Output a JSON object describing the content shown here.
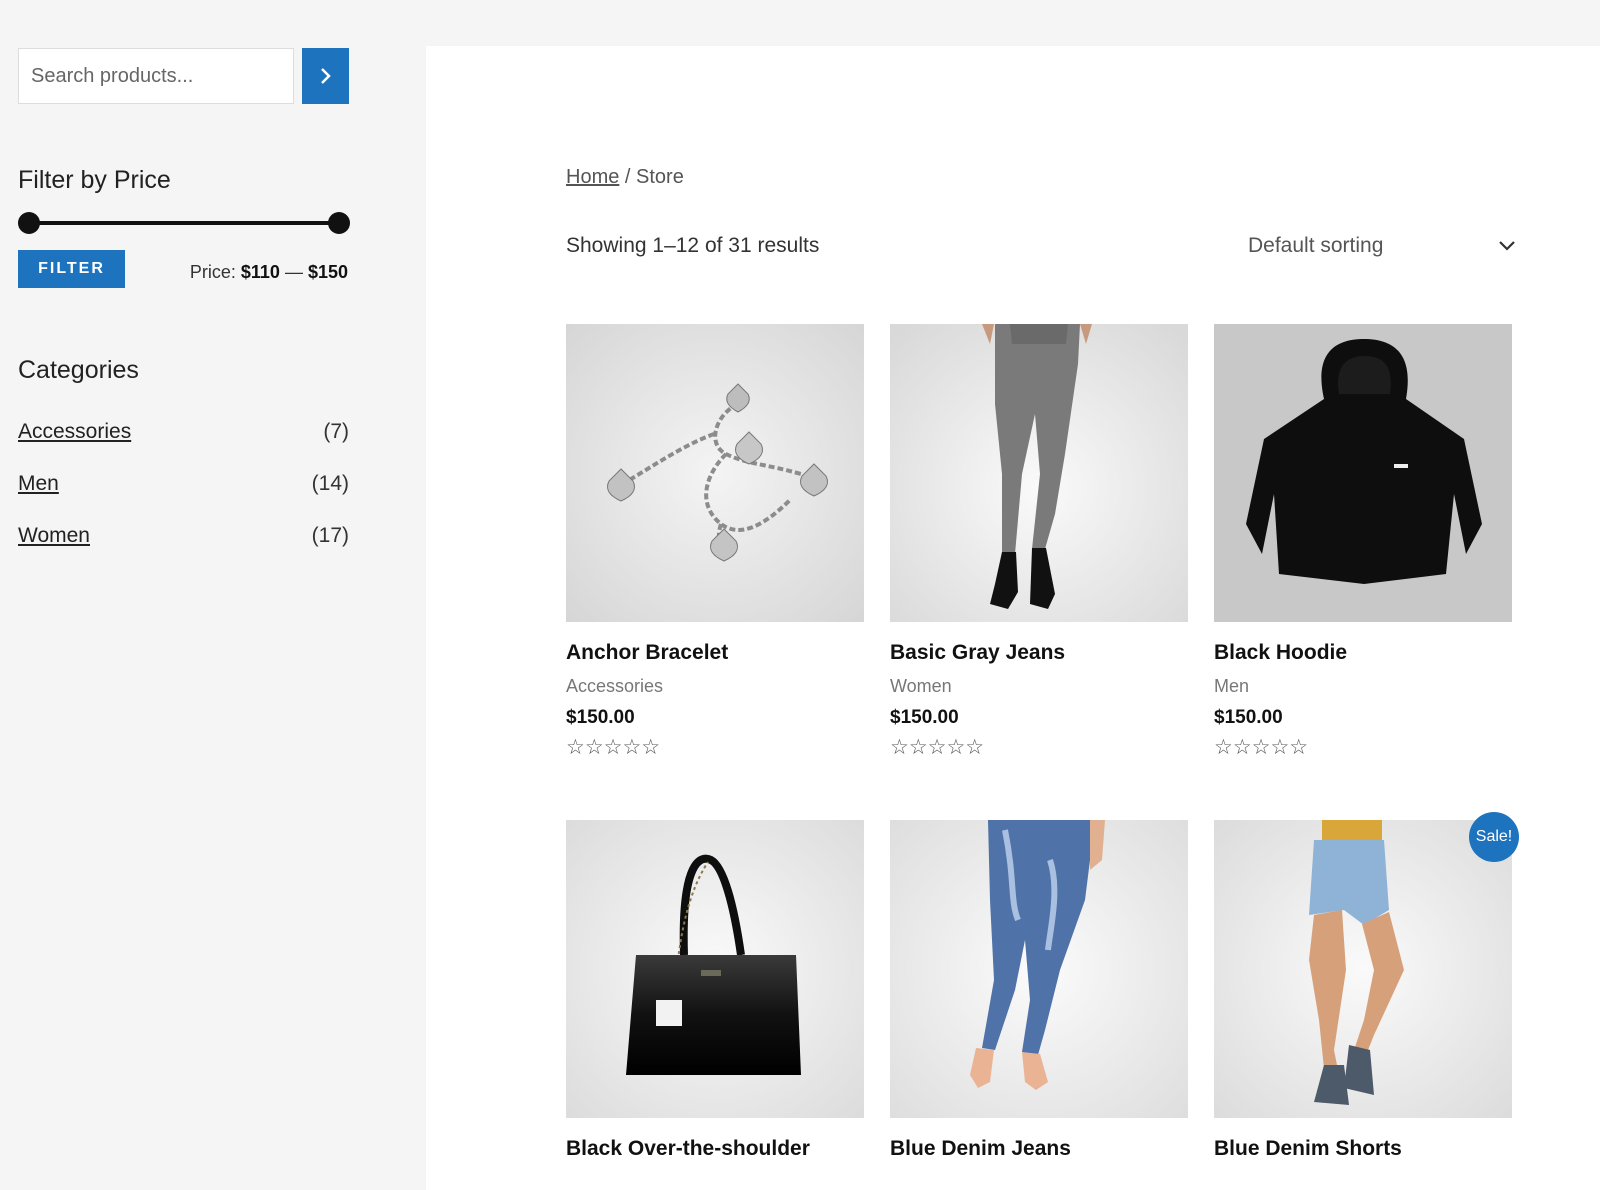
{
  "search": {
    "placeholder": "Search products..."
  },
  "price_filter": {
    "title": "Filter by Price",
    "button_label": "Filter",
    "price_prefix": "Price: ",
    "min_price": "$110",
    "separator": " — ",
    "max_price": "$150"
  },
  "categories": {
    "title": "Categories",
    "items": [
      {
        "label": "Accessories",
        "count": "(7)"
      },
      {
        "label": "Men",
        "count": "(14)"
      },
      {
        "label": "Women",
        "count": "(17)"
      }
    ]
  },
  "breadcrumb": {
    "home": "Home",
    "separator": " / ",
    "current": "Store"
  },
  "result_count": "Showing 1–12 of 31 results",
  "sorting": {
    "selected": "Default sorting"
  },
  "products": [
    {
      "title": "Anchor Bracelet",
      "category": "Accessories",
      "price": "$150.00",
      "rating": "☆☆☆☆☆"
    },
    {
      "title": "Basic Gray Jeans",
      "category": "Women",
      "price": "$150.00",
      "rating": "☆☆☆☆☆"
    },
    {
      "title": "Black Hoodie",
      "category": "Men",
      "price": "$150.00",
      "rating": "☆☆☆☆☆"
    },
    {
      "title": "Black Over-the-shoulder",
      "category": "",
      "price": "",
      "rating": ""
    },
    {
      "title": "Blue Denim Jeans",
      "category": "",
      "price": "",
      "rating": ""
    },
    {
      "title": "Blue Denim Shorts",
      "category": "",
      "price": "",
      "rating": "",
      "badge": "Sale!"
    }
  ],
  "colors": {
    "accent": "#1e73be",
    "sidebar_bg": "#f5f5f5",
    "main_bg": "#ffffff"
  }
}
